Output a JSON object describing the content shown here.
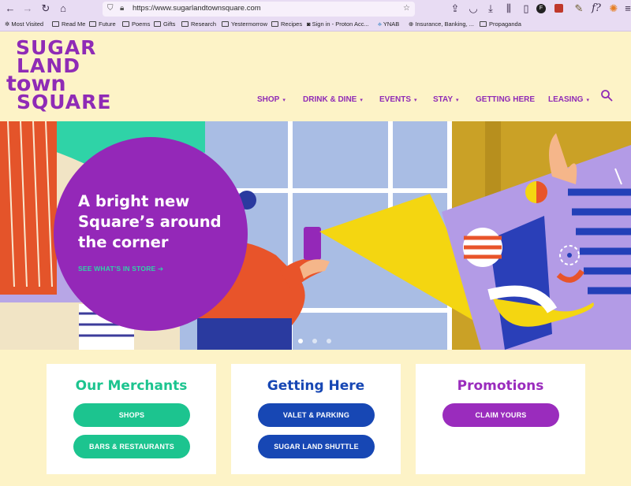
{
  "browser": {
    "url": "https://www.sugarlandtownsquare.com",
    "bookmarks": [
      "Most Visited",
      "Read Me",
      "Future",
      "Poems",
      "Gifts",
      "Research",
      "Yestermorrow",
      "Recipes",
      "Sign in - Proton Acc...",
      "YNAB",
      "Insurance, Banking, ...",
      "Propaganda"
    ]
  },
  "site": {
    "logo_lines": [
      "SUGAR",
      "LAND",
      "town",
      "SQUARE"
    ],
    "nav": [
      {
        "label": "SHOP",
        "dropdown": true
      },
      {
        "label": "DRINK & DINE",
        "dropdown": true
      },
      {
        "label": "EVENTS",
        "dropdown": true
      },
      {
        "label": "STAY",
        "dropdown": true
      },
      {
        "label": "GETTING HERE",
        "dropdown": false
      },
      {
        "label": "LEASING",
        "dropdown": true
      }
    ],
    "hero": {
      "headline": "A bright new Square’s around the corner",
      "cta": "SEE WHAT’S IN STORE ➔",
      "slide_count": 3,
      "active_slide": 1
    },
    "cards": [
      {
        "title": "Our Merchants",
        "color": "#1cc48f",
        "buttons": [
          "SHOPS",
          "BARS & RESTAURANTS"
        ]
      },
      {
        "title": "Getting Here",
        "color": "#1747b4",
        "buttons": [
          "VALET & PARKING",
          "SUGAR LAND SHUTTLE"
        ]
      },
      {
        "title": "Promotions",
        "color": "#9a2cbd",
        "buttons": [
          "CLAIM YOURS"
        ]
      }
    ]
  },
  "colors": {
    "brand_purple": "#8f2bb6",
    "cream": "#fdf3c7",
    "browser_chrome": "#e8dcf3"
  }
}
